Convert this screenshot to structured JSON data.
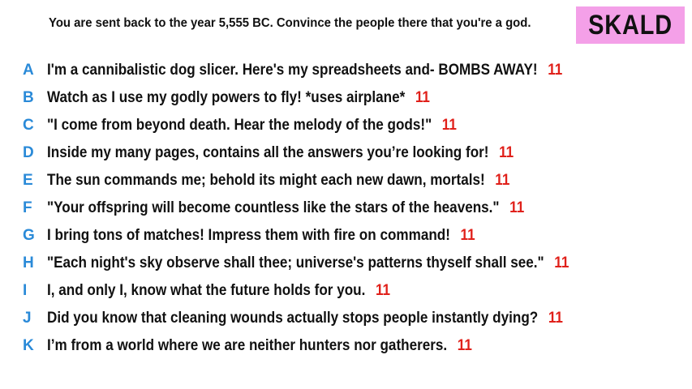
{
  "prompt": "You are sent back to the year 5,555 BC. Convince the people there that you're a god.",
  "player": "SKALD",
  "colors": {
    "letter": "#2a8ad8",
    "score": "#e0201a",
    "badge": "#f4a0e8"
  },
  "answers": [
    {
      "letter": "A",
      "text": "I'm a cannibalistic dog slicer. Here's my spreadsheets and- BOMBS AWAY!",
      "score": "11"
    },
    {
      "letter": "B",
      "text": "Watch as I use my godly powers to fly!  *uses airplane*",
      "score": "11"
    },
    {
      "letter": "C",
      "text": "\"I come from beyond death. Hear the melody of the gods!\"",
      "score": "11"
    },
    {
      "letter": "D",
      "text": "Inside my many pages, contains all the answers you’re looking for!",
      "score": "11"
    },
    {
      "letter": "E",
      "text": "The sun commands me; behold its might each new dawn, mortals!",
      "score": "11"
    },
    {
      "letter": "F",
      "text": "\"Your offspring will become countless like the stars of the heavens.\"",
      "score": "11"
    },
    {
      "letter": "G",
      "text": "I bring tons of matches! Impress them with fire on command!",
      "score": "11"
    },
    {
      "letter": "H",
      "text": "\"Each night's sky observe shall thee; universe's patterns thyself shall see.\"",
      "score": "11"
    },
    {
      "letter": "I",
      "text": "I, and only I, know what the future holds for you.",
      "score": "11"
    },
    {
      "letter": "J",
      "text": "Did you know that cleaning wounds actually stops people instantly dying?",
      "score": "11"
    },
    {
      "letter": "K",
      "text": "I’m from a world where we are neither hunters nor gatherers.",
      "score": "11"
    }
  ]
}
